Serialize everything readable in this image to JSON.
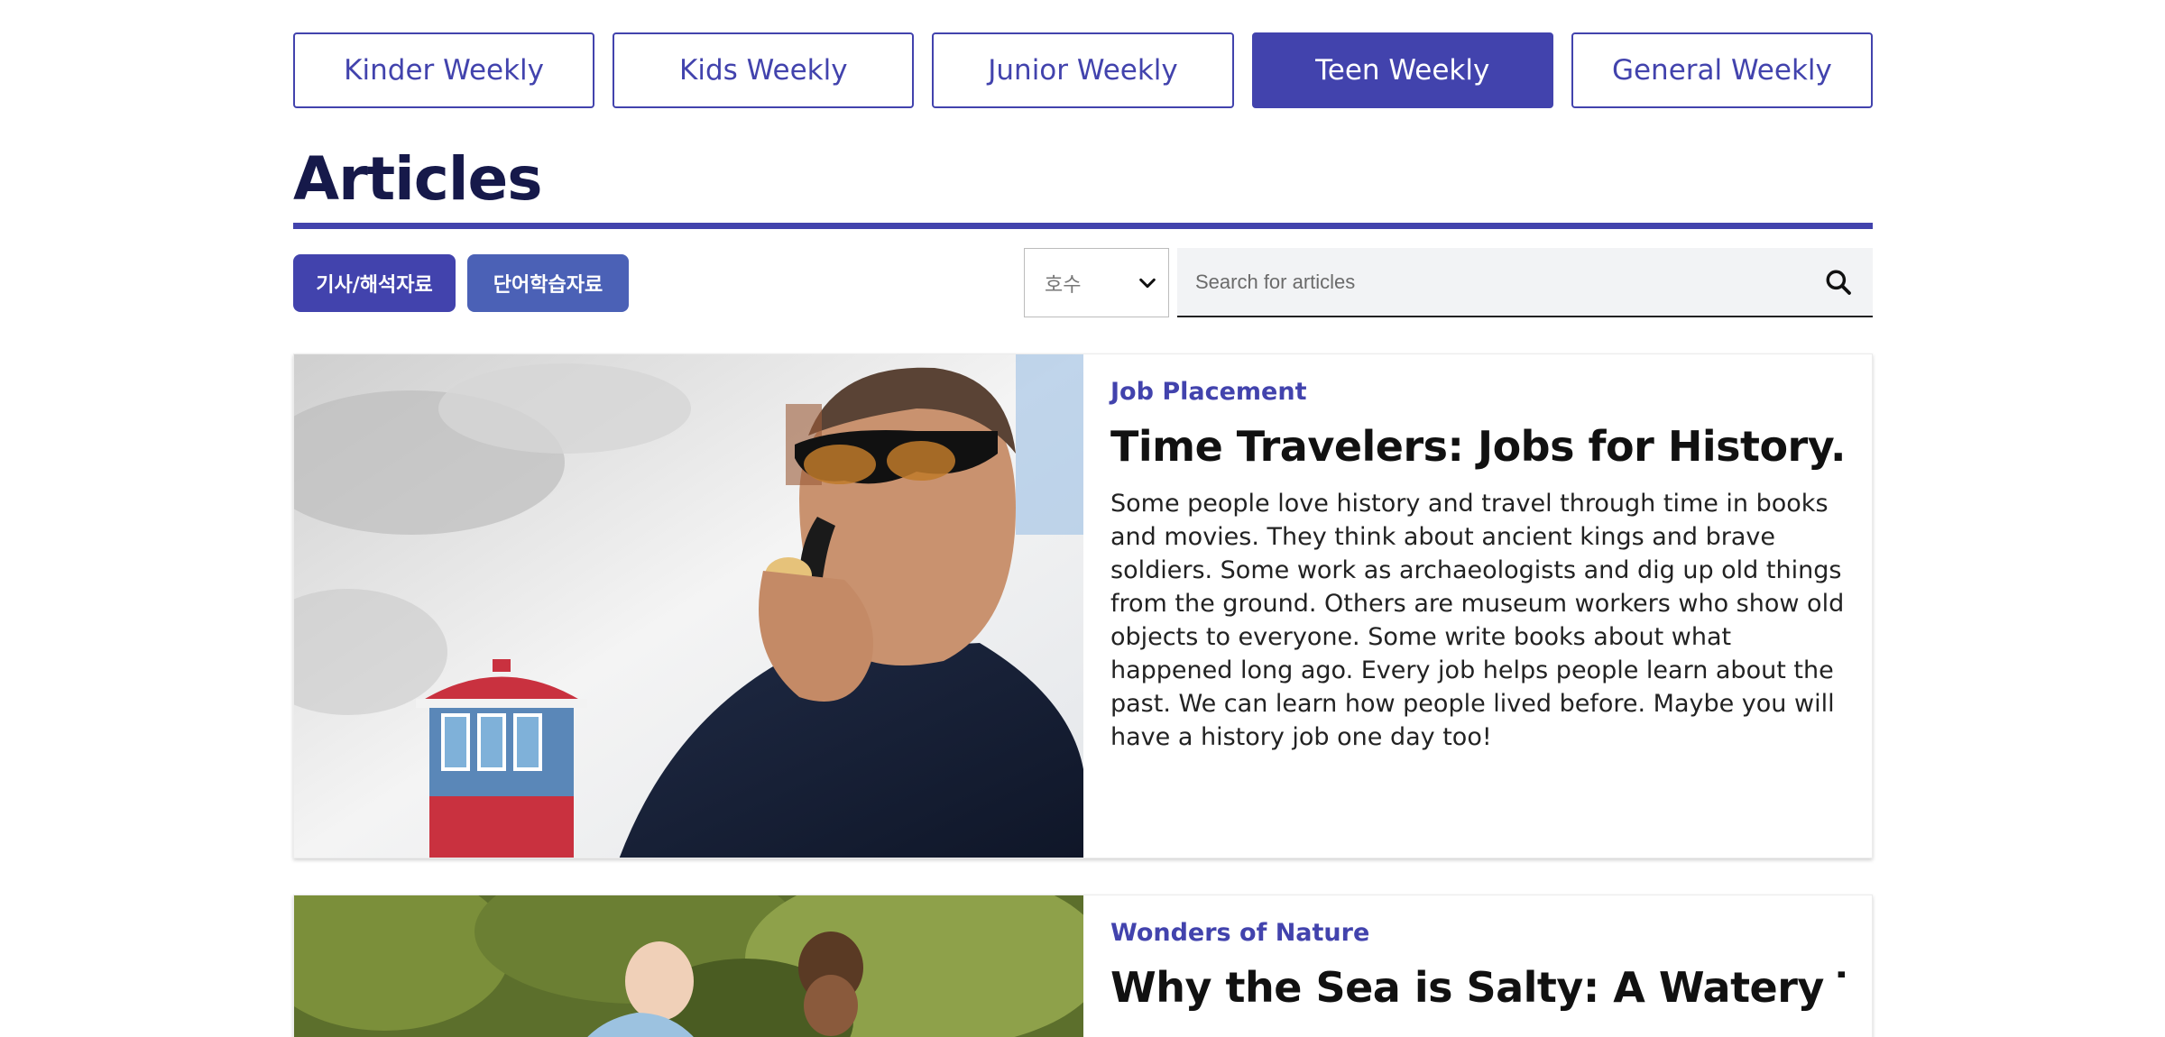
{
  "tabs": [
    {
      "label": "Kinder Weekly",
      "active": false
    },
    {
      "label": "Kids Weekly",
      "active": false
    },
    {
      "label": "Junior Weekly",
      "active": false
    },
    {
      "label": "Teen Weekly",
      "active": true
    },
    {
      "label": "General Weekly",
      "active": false
    }
  ],
  "page_title": "Articles",
  "type_buttons": {
    "articles_label": "기사/해석자료",
    "vocab_label": "단어학습자료"
  },
  "issue_select": {
    "selected": "호수",
    "icon": "chevron-down-icon"
  },
  "search": {
    "placeholder": "Search for articles",
    "value": "",
    "icon": "search-icon"
  },
  "articles": [
    {
      "category": "Job Placement",
      "title": "Time Travelers: Jobs for History...",
      "summary": "Some people love history and travel through time in books and movies. They think about ancient kings and brave soldiers. Some work as archaeologists and dig up old things from the ground. Others are museum workers who show old objects to everyone. Some write books about what happened long ago. Every job helps people learn about the past. We can learn how people lived before. Maybe you will have a history job one day too!"
    },
    {
      "category": "Wonders of Nature",
      "title": "Why the Sea is Salty: A Watery Tale",
      "summary": ""
    }
  ],
  "colors": {
    "accent": "#4243ad",
    "accent_secondary": "#4b61b6",
    "title": "#16194a"
  }
}
